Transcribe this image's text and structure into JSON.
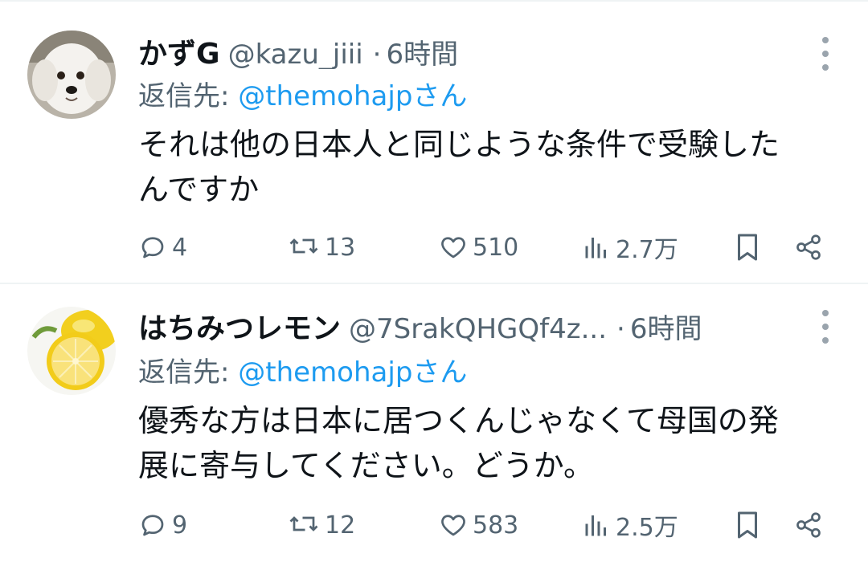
{
  "tweets": [
    {
      "name": "かずG",
      "handle": "@kazu_jiii",
      "separator": "·",
      "time": "6時間",
      "reply_prefix": "返信先: ",
      "reply_mention": "@themohajpさん",
      "text_line1": "それは他の日本人と同じような条件で受験した",
      "text_line2": "んですか",
      "replies": "4",
      "retweets": "13",
      "likes": "510",
      "views": "2.7万",
      "avatar": "white-dog-avatar"
    },
    {
      "name": "はちみつレモン",
      "handle": "@7SrakQHGQf4z...",
      "separator": "·",
      "time": "6時間",
      "reply_prefix": "返信先: ",
      "reply_mention": "@themohajpさん",
      "text_line1": "優秀な方は日本に居つくんじゃなくて母国の発",
      "text_line2": "展に寄与してください。どうか。",
      "replies": "9",
      "retweets": "12",
      "likes": "583",
      "views": "2.5万",
      "avatar": "lemon-avatar"
    }
  ],
  "colors": {
    "text": "#0f1419",
    "secondary": "#536471",
    "link": "#1d9bf0",
    "divider": "#eff3f4"
  }
}
